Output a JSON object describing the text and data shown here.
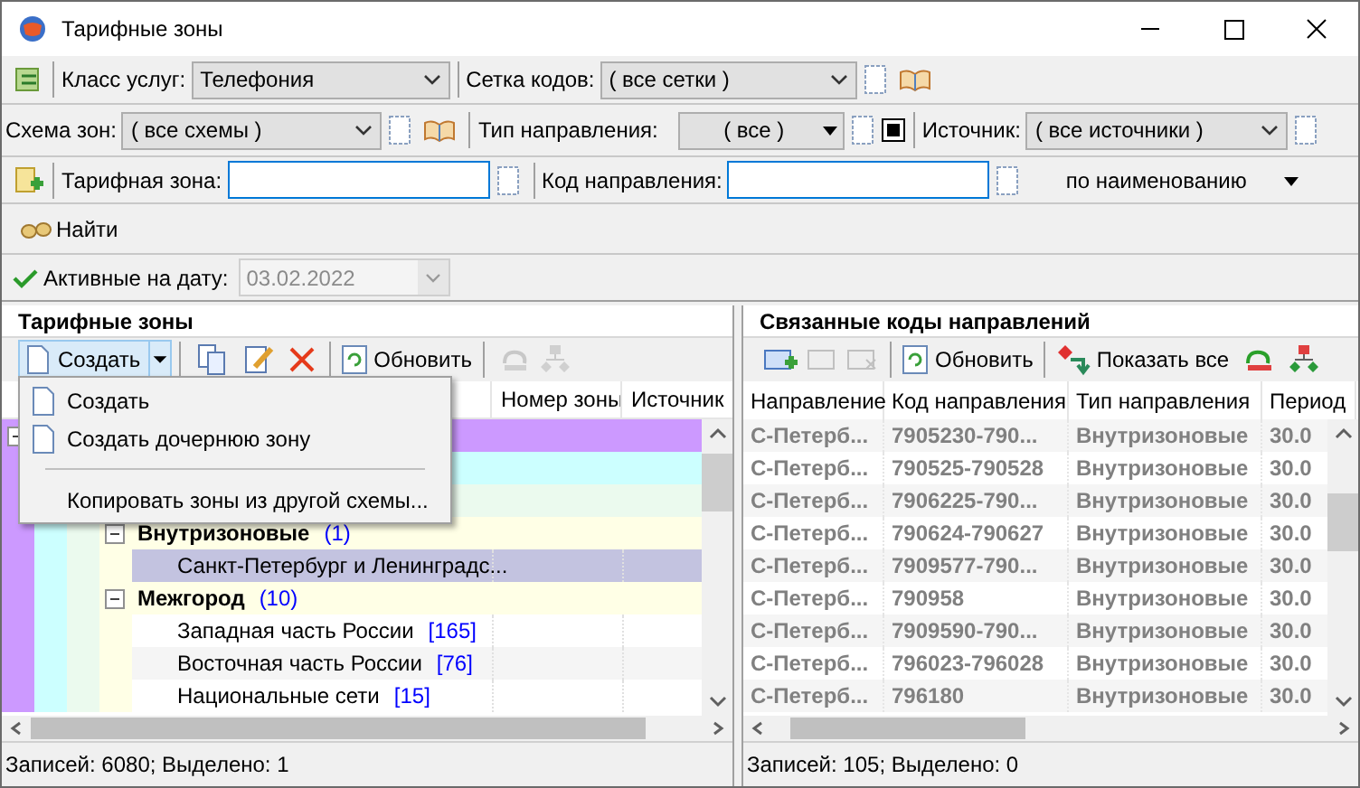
{
  "window": {
    "title": "Тарифные зоны"
  },
  "service_class": {
    "label": "Класс услуг:",
    "value": "Телефония"
  },
  "code_grid": {
    "label": "Сетка кодов:",
    "value": "( все сетки )"
  },
  "zone_scheme": {
    "label": "Схема зон:",
    "value": "( все схемы )"
  },
  "direction_type": {
    "label": "Тип направления:",
    "value": "( все )"
  },
  "source": {
    "label": "Источник:",
    "value": "( все источники )"
  },
  "tariff_zone": {
    "label": "Тарифная зона:"
  },
  "direction_code": {
    "label": "Код направления:"
  },
  "sort_mode": {
    "value": "по наименованию"
  },
  "find_button": {
    "label": "Найти"
  },
  "active_date": {
    "label": "Активные на дату:",
    "value": "03.02.2022",
    "disabled": true
  },
  "zones_panel": {
    "title": "Тарифные зоны",
    "create_button": "Создать",
    "refresh_button": "Обновить",
    "create_menu": [
      {
        "kind": "item",
        "label": "Создать"
      },
      {
        "kind": "item",
        "label": "Создать дочернюю зону"
      },
      {
        "kind": "separator"
      },
      {
        "kind": "plain",
        "label": "Копировать зоны из другой схемы..."
      }
    ],
    "columns": [
      "Номер зоны",
      "Источник"
    ],
    "tree": [
      {
        "expanded": true,
        "children": [
          {
            "children": [
              {
                "children": [
                  {
                    "label": "Внутризоновые",
                    "count": "(1)",
                    "expanded": true,
                    "children": [
                      {
                        "label": "Санкт-Петербург и Ленинградс...",
                        "selected": true
                      }
                    ]
                  },
                  {
                    "label": "Межгород",
                    "count": "(10)",
                    "expanded": true,
                    "children": [
                      {
                        "label": "Западная часть России",
                        "count": "[165]",
                        "selected": false
                      },
                      {
                        "label": "Восточная часть России",
                        "count": "[76]",
                        "selected": false
                      },
                      {
                        "label": "Национальные сети",
                        "count": "[15]",
                        "selected": false
                      }
                    ]
                  }
                ]
              }
            ]
          }
        ]
      }
    ],
    "status": "Записей: 6080; Выделено: 1"
  },
  "codes_panel": {
    "title": "Связанные коды направлений",
    "refresh_button": "Обновить",
    "show_all_button": "Показать все",
    "columns": [
      "Направление",
      "Код направления",
      "Тип направления",
      "Период"
    ],
    "rows": [
      [
        "С-Петерб...",
        "7905230-790...",
        "Внутризоновые",
        "30.0"
      ],
      [
        "С-Петерб...",
        "790525-790528",
        "Внутризоновые",
        "30.0"
      ],
      [
        "С-Петерб...",
        "7906225-790...",
        "Внутризоновые",
        "30.0"
      ],
      [
        "С-Петерб...",
        "790624-790627",
        "Внутризоновые",
        "30.0"
      ],
      [
        "С-Петерб...",
        "7909577-790...",
        "Внутризоновые",
        "30.0"
      ],
      [
        "С-Петерб...",
        "790958",
        "Внутризоновые",
        "30.0"
      ],
      [
        "С-Петерб...",
        "7909590-790...",
        "Внутризоновые",
        "30.0"
      ],
      [
        "С-Петерб...",
        "796023-796028",
        "Внутризоновые",
        "30.0"
      ],
      [
        "С-Петерб...",
        "796180",
        "Внутризоновые",
        "30.0"
      ]
    ],
    "status": "Записей: 105; Выделено: 0"
  }
}
